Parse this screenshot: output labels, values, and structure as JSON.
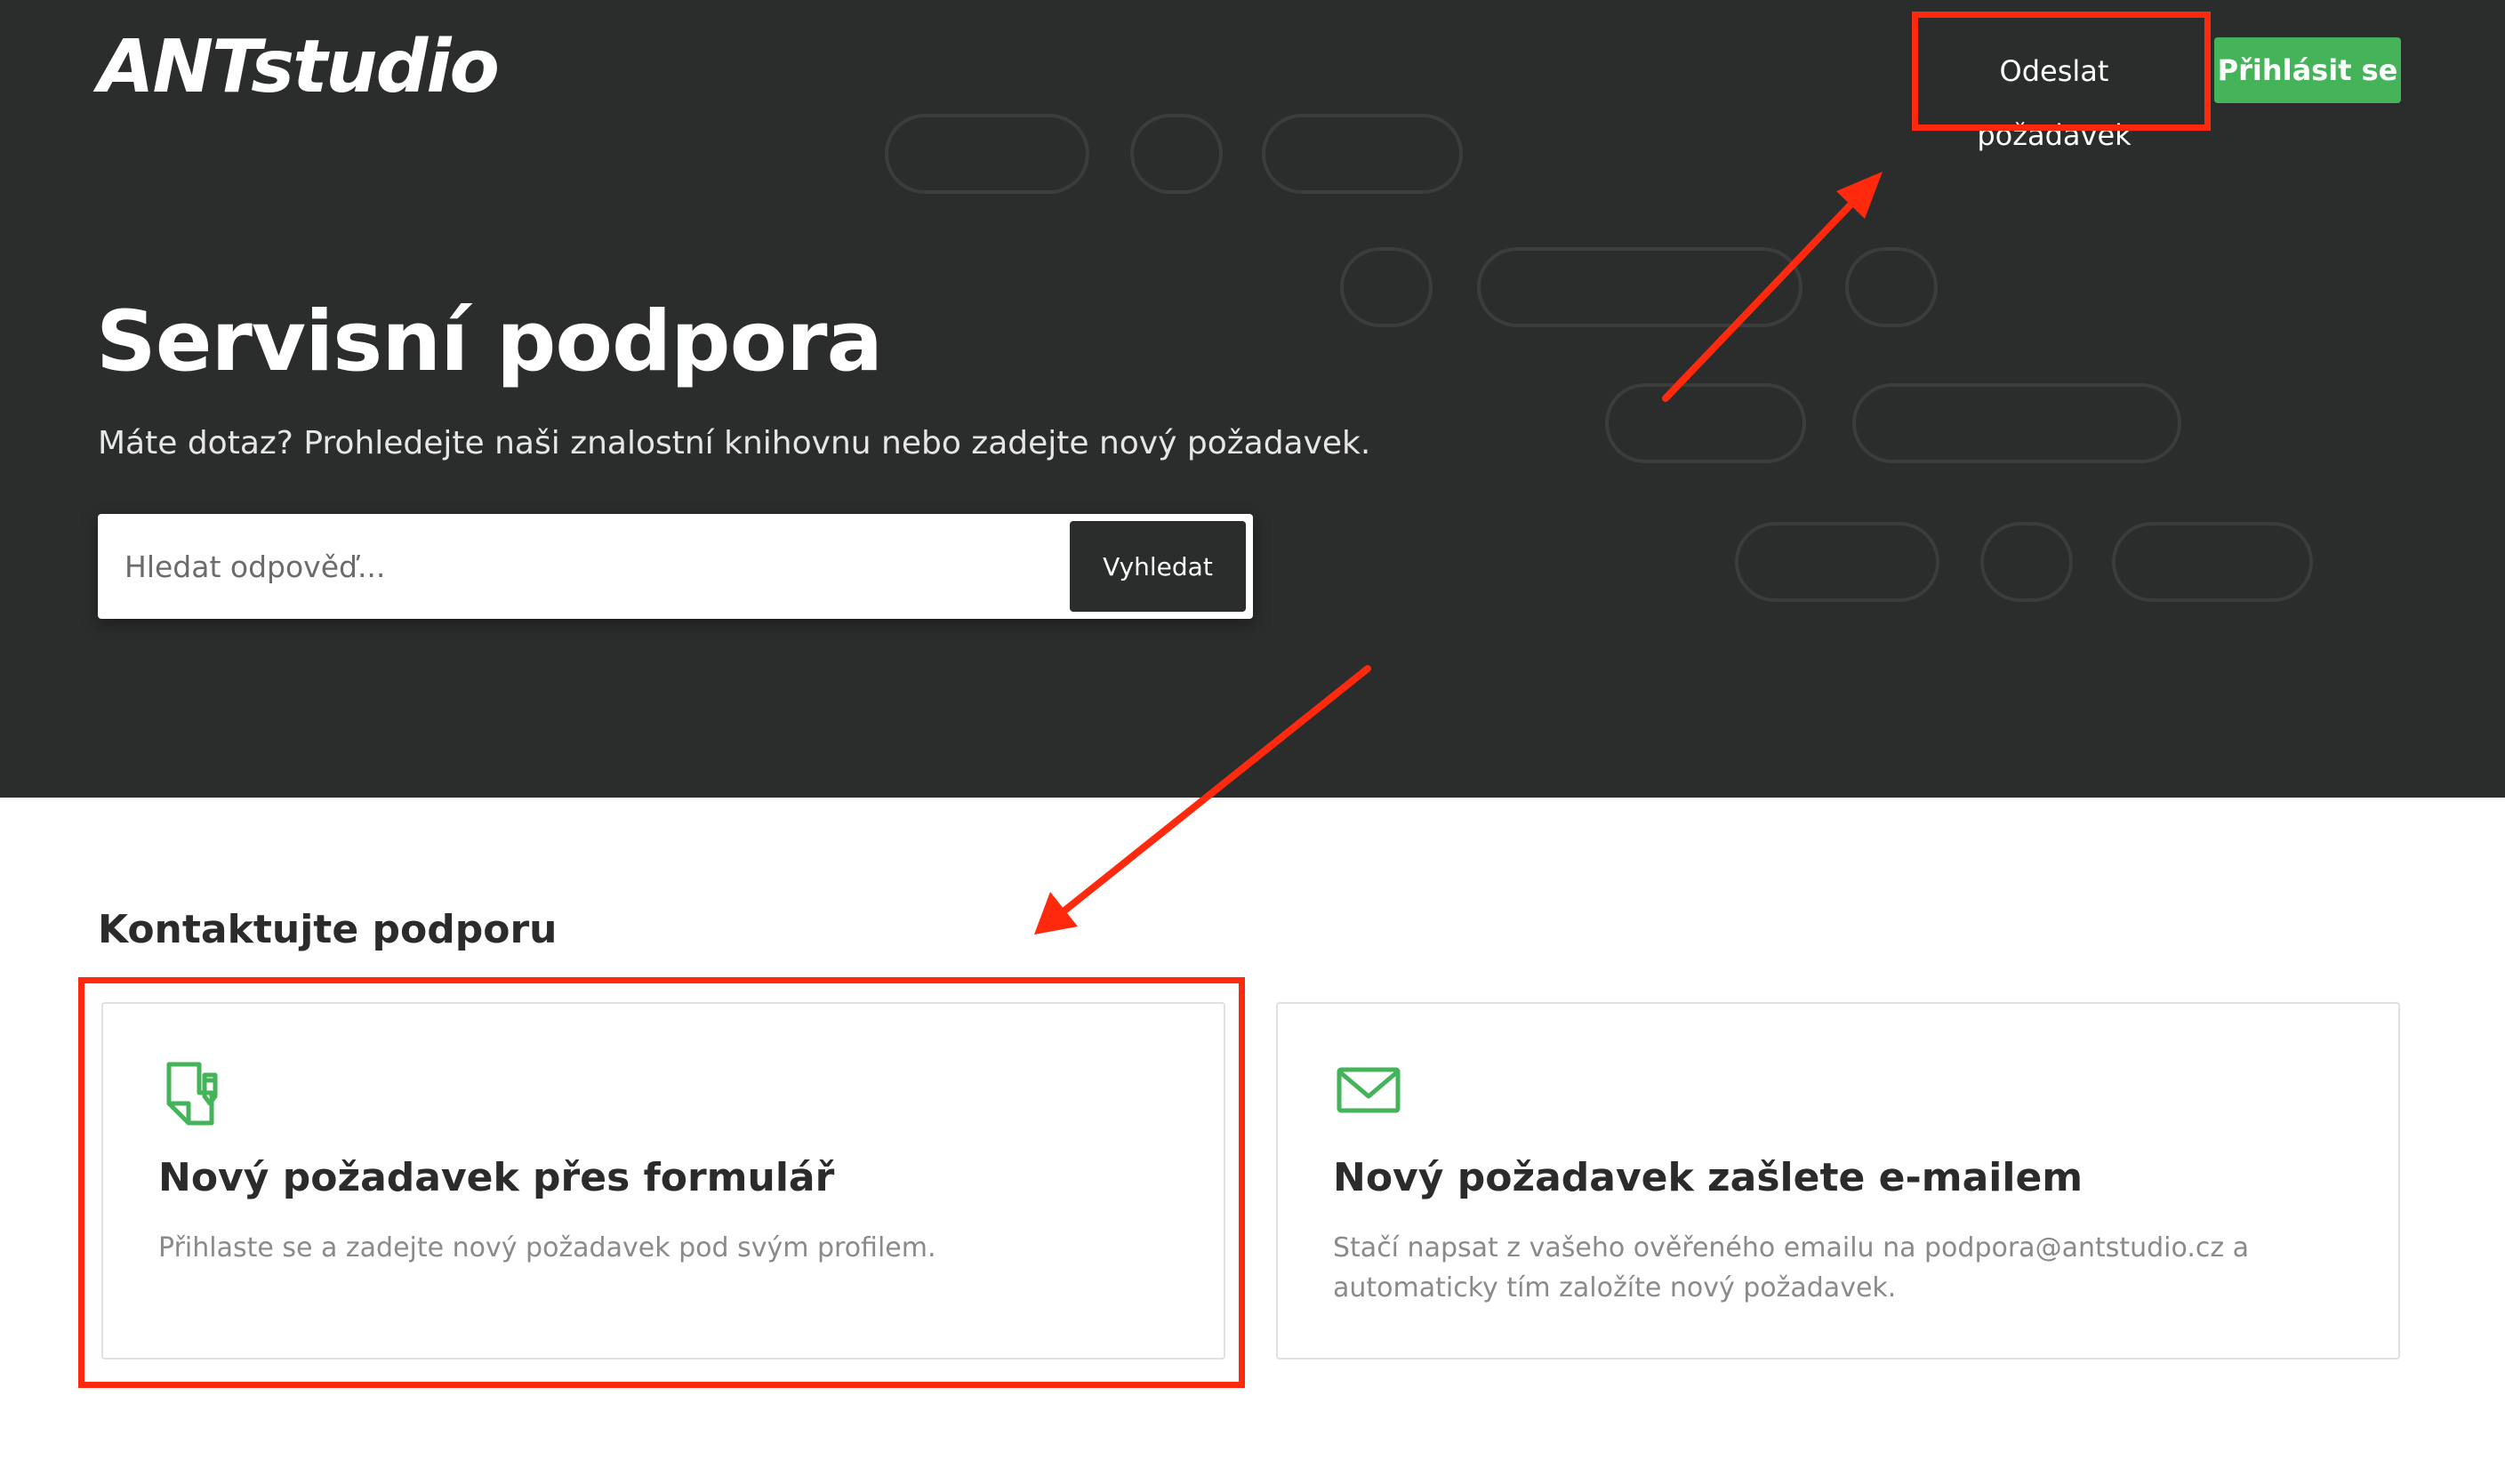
{
  "header": {
    "logo_text": "ANTstudio",
    "nav_request_label": "Odeslat požadavek",
    "nav_login_label": "Přihlásit se"
  },
  "hero": {
    "title": "Servisní podpora",
    "subtitle": "Máte dotaz? Prohledejte naši znalostní knihovnu nebo zadejte nový požadavek.",
    "search": {
      "placeholder": "Hledat odpověď...",
      "button_label": "Vyhledat"
    }
  },
  "contact": {
    "section_title": "Kontaktujte podporu",
    "cards": [
      {
        "icon": "document-form-icon",
        "title": "Nový požadavek přes formulář",
        "description": "Přihlaste se a zadejte nový požadavek pod svým profilem."
      },
      {
        "icon": "envelope-icon",
        "title": "Nový požadavek zašlete e-mailem",
        "description": "Stačí napsat z vašeho ověřeného emailu na podpora@antstudio.cz a automaticky tím založíte nový požadavek."
      }
    ]
  },
  "colors": {
    "hero_background": "#2b2c2c",
    "accent_green": "#45b35a",
    "annotation_red": "#ff2a0e"
  }
}
